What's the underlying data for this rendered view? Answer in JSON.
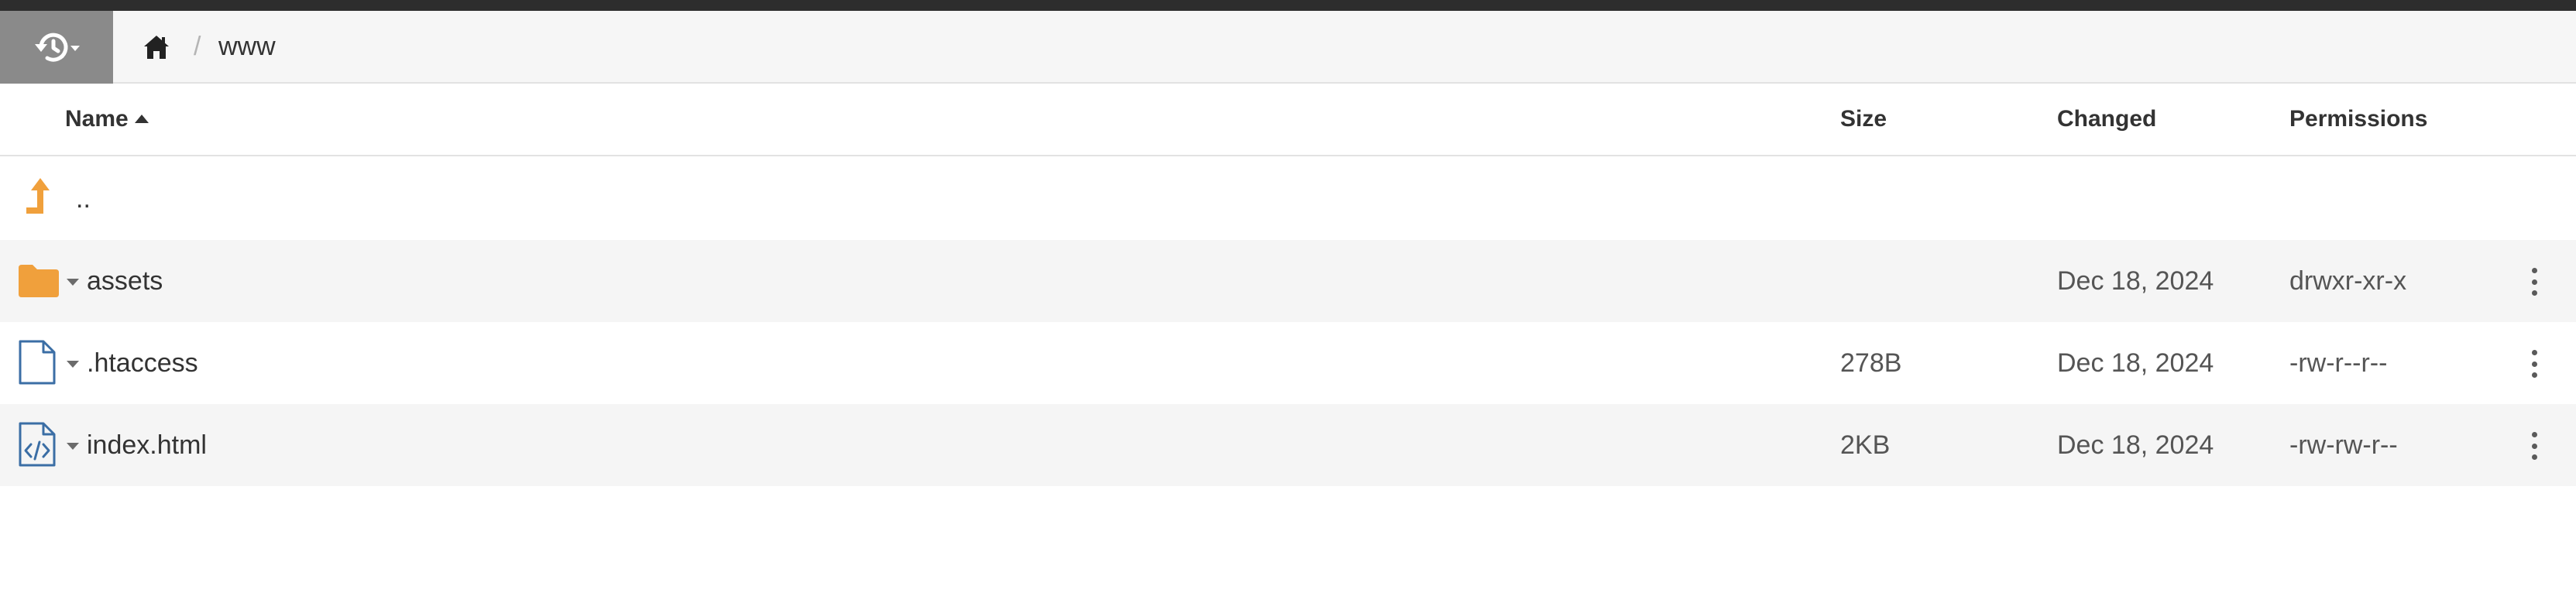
{
  "navbar": {
    "history_icon": "history-icon",
    "home_icon": "home-icon",
    "separator": "/",
    "current_folder": "www"
  },
  "table": {
    "headers": {
      "name": "Name",
      "size": "Size",
      "changed": "Changed",
      "permissions": "Permissions"
    },
    "sort": {
      "column": "Name",
      "direction": "ascending"
    },
    "parent": {
      "label": "..",
      "icon": "level-up-icon"
    },
    "rows": [
      {
        "name": "assets",
        "type": "folder",
        "icon": "folder-icon",
        "size": "",
        "changed": "Dec 18, 2024",
        "permissions": "drwxr-xr-x"
      },
      {
        "name": ".htaccess",
        "type": "file",
        "icon": "file-icon",
        "size": "278B",
        "changed": "Dec 18, 2024",
        "permissions": "-rw-r--r--"
      },
      {
        "name": "index.html",
        "type": "code",
        "icon": "code-file-icon",
        "size": "2KB",
        "changed": "Dec 18, 2024",
        "permissions": "-rw-rw-r--"
      }
    ]
  },
  "colors": {
    "topbar": "#2d2d2d",
    "navbar_bg": "#f6f6f6",
    "history_button_bg": "#8a8a8a",
    "folder_orange": "#f0a03c",
    "file_blue": "#3b6ea5",
    "row_shade": "#f5f5f5"
  }
}
